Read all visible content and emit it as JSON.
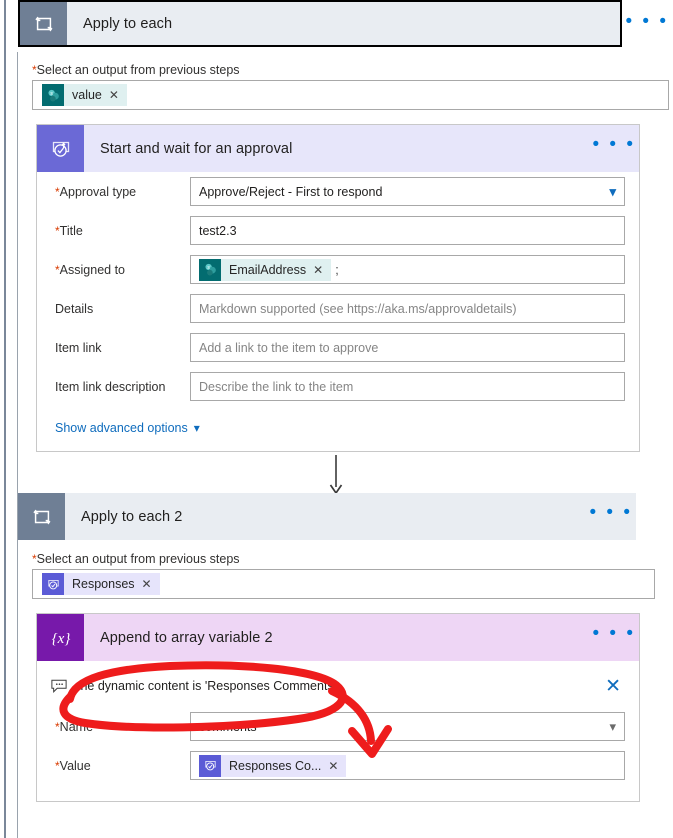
{
  "outer_scope": {
    "title": "Apply to each",
    "icon": "loop-icon",
    "menu": "• • •",
    "output_label": "Select an output from previous steps",
    "required_star": "*",
    "token": {
      "label": "value",
      "icon": "sharepoint-icon",
      "remove": "✕"
    }
  },
  "approval_card": {
    "title": "Start and wait for an approval",
    "icon": "approval-icon",
    "menu": "• • •",
    "fields": [
      {
        "label": "Approval type",
        "required": "*",
        "value": "Approve/Reject - First to respond",
        "chevron": "chevron-down-icon",
        "placeholder": false
      },
      {
        "label": "Title",
        "required": "*",
        "value": "test2.3",
        "placeholder": false
      },
      {
        "label": "Details",
        "required": "",
        "value": "Markdown supported (see https://aka.ms/approvaldetails)",
        "placeholder": true
      },
      {
        "label": "Item link",
        "required": "",
        "value": "Add a link to the item to approve",
        "placeholder": true
      },
      {
        "label": "Item link description",
        "required": "",
        "value": "Describe the link to the item",
        "placeholder": true
      }
    ],
    "assigned_to": {
      "label": "Assigned to",
      "required": "*",
      "token": {
        "label": "EmailAddress",
        "icon": "sharepoint-icon",
        "remove": "✕"
      },
      "separator": ";"
    },
    "advanced_options": {
      "label": "Show advanced options",
      "chevron": "chevron-down-icon"
    }
  },
  "inner_scope": {
    "title": "Apply to each 2",
    "icon": "loop-icon",
    "menu": "• • •",
    "output_label": "Select an output from previous steps",
    "required_star": "*",
    "token": {
      "label": "Responses",
      "icon": "approval-icon",
      "remove": "✕"
    }
  },
  "variable_card": {
    "title": "Append to array variable 2",
    "icon": "variable-icon",
    "menu": "• • •",
    "comment": {
      "text": "the dynamic content is 'Responses Comments'",
      "icon": "comment-icon",
      "close": "✕"
    },
    "name_field": {
      "label": "Name",
      "required": "*",
      "value": "comments",
      "chevron": "chevron-down-icon"
    },
    "value_field": {
      "label": "Value",
      "required": "*",
      "token": {
        "label": "Responses Co...",
        "icon": "approval-icon",
        "remove": "✕"
      }
    }
  },
  "colors": {
    "loop_icon_bg": "#6f7f95",
    "approval_icon_bg": "#6b69d6",
    "variable_icon_bg": "#7719aa",
    "approval_header_bg": "#e7e6fa",
    "variable_header_bg": "#eed6f5",
    "scope_header_bg": "#e9edf2",
    "link_blue": "#0f6cbd",
    "required_red": "#d83b01",
    "annotation_red": "#ee1c1c",
    "sharepoint_teal": "#036c70"
  },
  "annotation": {
    "shape": "red-ellipse-with-arrow",
    "meaning": "highlights comment text and points to Value token"
  }
}
